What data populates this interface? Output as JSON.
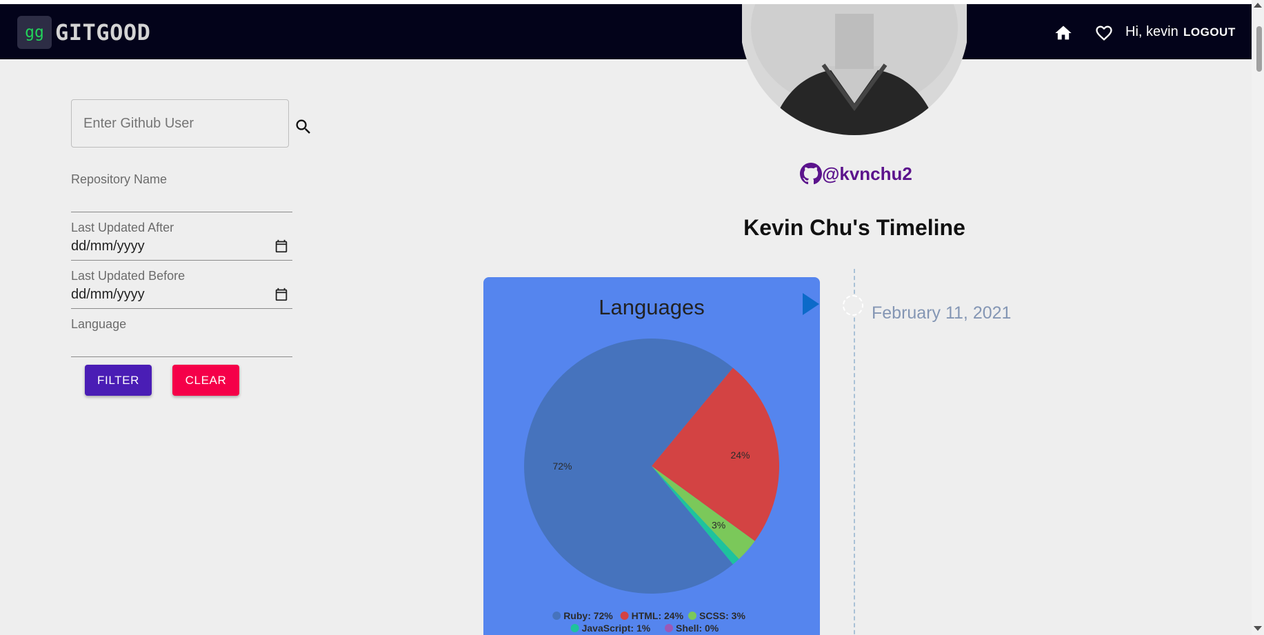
{
  "app": {
    "logo_mark": "gg",
    "name": "GITGOOD"
  },
  "nav": {
    "home_icon": "home-icon",
    "favorites_icon": "heart-icon",
    "greeting": "Hi, kevin",
    "logout_label": "LOGOUT"
  },
  "sidebar": {
    "search": {
      "placeholder": "Enter Github User",
      "value": "",
      "icon": "search-icon"
    },
    "repository_name": {
      "label": "Repository Name",
      "value": ""
    },
    "last_updated_after": {
      "label": "Last Updated After",
      "value": "dd/mm/yyyy"
    },
    "last_updated_before": {
      "label": "Last Updated Before",
      "value": "dd/mm/yyyy"
    },
    "language": {
      "label": "Language",
      "value": ""
    },
    "filter_label": "FILTER",
    "clear_label": "CLEAR"
  },
  "profile": {
    "username": "@kvnchu2",
    "timeline_title": "Kevin Chu's Timeline"
  },
  "timeline": {
    "entries": [
      {
        "date": "February 11, 2021"
      }
    ]
  },
  "colors": {
    "navbar": "#03031a",
    "filter_button": "#4a1db5",
    "clear_button": "#f50049",
    "card_background": "#5585ee",
    "handle": "#5b138c"
  },
  "chart_data": {
    "type": "pie",
    "title": "Languages",
    "categories": [
      "Ruby",
      "HTML",
      "SCSS",
      "JavaScript",
      "Shell"
    ],
    "values": [
      72,
      24,
      3,
      1,
      0
    ],
    "slice_labels": [
      "72%",
      "24%",
      "3%",
      "",
      ""
    ],
    "legend": [
      "Ruby: 72%",
      "HTML: 24%",
      "SCSS: 3%",
      "JavaScript: 1%",
      "Shell: 0%"
    ],
    "colors": [
      "#4673bd",
      "#d34343",
      "#7bc85a",
      "#1ec39d",
      "#9b59b6"
    ],
    "legend_position": "bottom"
  }
}
